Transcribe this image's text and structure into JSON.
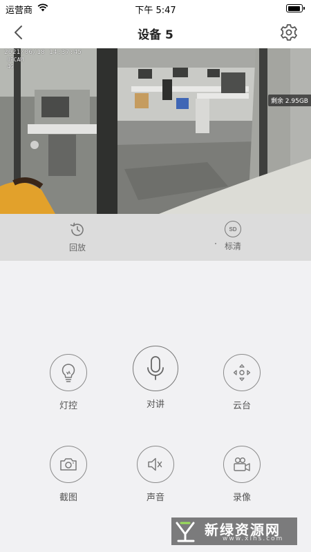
{
  "status_bar": {
    "carrier": "运营商",
    "time": "下午 5:47",
    "battery_level": 0.9
  },
  "nav": {
    "title": "设备 5"
  },
  "video": {
    "osd_timestamp": "2021/06/18 14:37:45",
    "osd_line1": "UPCAM",
    "osd_line2": "4G",
    "storage_badge": "剩余 2.95GB"
  },
  "quick_bar": {
    "items": [
      {
        "label": "回放",
        "icon": "history-icon"
      },
      {
        "label": "标清",
        "icon": "sd-quality-icon",
        "badge": "SD"
      }
    ]
  },
  "controls": {
    "light": {
      "label": "灯控",
      "icon": "lightbulb-icon"
    },
    "talk": {
      "label": "对讲",
      "icon": "microphone-icon"
    },
    "ptz": {
      "label": "云台",
      "icon": "ptz-arrows-icon"
    },
    "snapshot": {
      "label": "截图",
      "icon": "camera-icon"
    },
    "sound": {
      "label": "声音",
      "icon": "speaker-muted-icon"
    },
    "record": {
      "label": "录像",
      "icon": "video-camera-icon"
    }
  },
  "watermark": {
    "text": "新绿资源网",
    "url": "www.xlhs.com"
  },
  "colors": {
    "background": "#f1f1f3",
    "quick_bar": "#dcdcdc",
    "icon_gray": "#8a8a8a"
  }
}
